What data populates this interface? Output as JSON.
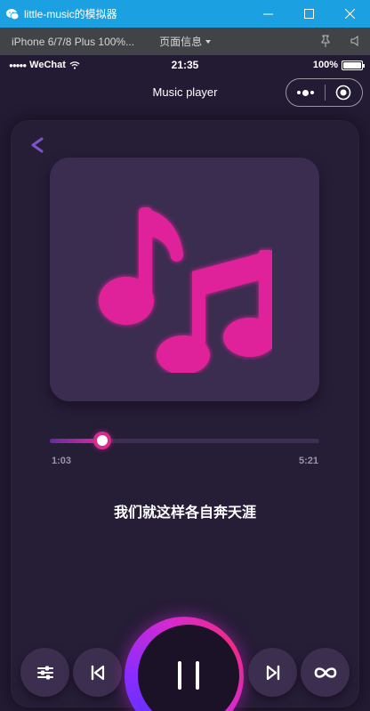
{
  "window": {
    "title": "little-music的模拟器"
  },
  "simulator": {
    "device": "iPhone 6/7/8 Plus 100%...",
    "page_info": "页面信息"
  },
  "status_bar": {
    "carrier": "WeChat",
    "time": "21:35",
    "battery": "100%"
  },
  "navbar": {
    "title": "Music player"
  },
  "player": {
    "current_time": "1:03",
    "total_time": "5:21",
    "progress_fraction": 0.196,
    "song_title": "我们就这样各自奔天涯"
  },
  "colors": {
    "accent": "#d82a8f",
    "background": "#231a33",
    "card": "#261d37",
    "artwork_bg": "#3a2d4f"
  },
  "icons": {
    "back": "chevron-left-icon",
    "settings": "sliders-icon",
    "previous": "skip-back-icon",
    "pause": "pause-icon",
    "next": "skip-forward-icon",
    "loop": "infinity-icon",
    "artwork": "music-notes-icon"
  }
}
